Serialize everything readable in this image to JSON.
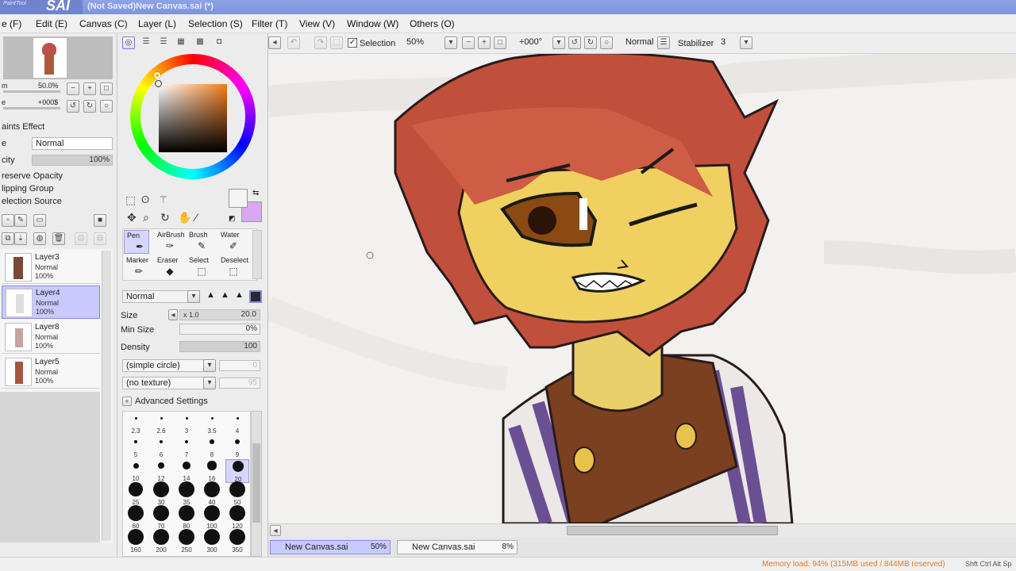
{
  "window": {
    "logo_small": "PaintTool",
    "logo": "SAI",
    "title": "(Not Saved)New Canvas.sai (*)"
  },
  "menu": [
    "e (F)",
    "Edit (E)",
    "Canvas (C)",
    "Layer (L)",
    "Selection (S)",
    "Filter (T)",
    "View (V)",
    "Window (W)",
    "Others (O)"
  ],
  "navigator": {
    "zoom": "50.0%",
    "angle": "+000$"
  },
  "layer_props": {
    "effect_label": "aints Effect",
    "mode_label": "e",
    "mode": "Normal",
    "opacity_label": "city",
    "opacity": "100%",
    "preserve_opacity": "reserve Opacity",
    "clipping_group": "lipping Group",
    "selection_source": "election Source"
  },
  "layers": [
    {
      "name": "Layer3",
      "mode": "Normal",
      "opacity": "100%"
    },
    {
      "name": "Layer4",
      "mode": "Normal",
      "opacity": "100%"
    },
    {
      "name": "Layer8",
      "mode": "Normal",
      "opacity": "100%"
    },
    {
      "name": "Layer5",
      "mode": "Normal",
      "opacity": "100%"
    }
  ],
  "colors": {
    "primary": "#f4f4f4",
    "secondary": "#d9a8f0",
    "ring_marker": "#ffffff",
    "accent_selected": "#c9c9ff"
  },
  "tools": [
    {
      "label": "Pen",
      "icon": "pen-icon"
    },
    {
      "label": "AirBrush",
      "icon": "airbrush-icon"
    },
    {
      "label": "Brush",
      "icon": "brush-icon"
    },
    {
      "label": "Water",
      "icon": "water-icon"
    },
    {
      "label": "Marker",
      "icon": "marker-icon"
    },
    {
      "label": "Eraser",
      "icon": "eraser-icon"
    },
    {
      "label": "Select",
      "icon": "select-icon"
    },
    {
      "label": "Deselect",
      "icon": "deselect-icon"
    }
  ],
  "brush": {
    "blend_mode": "Normal",
    "size_label": "Size",
    "size_mult": "x 1.0",
    "size": "20.0",
    "min_size_label": "Min Size",
    "min_size": "0%",
    "density_label": "Density",
    "density": "100",
    "shape": "(simple circle)",
    "shape_val": "0",
    "texture": "(no texture)",
    "texture_val": "95",
    "advanced": "Advanced Settings"
  },
  "brush_sizes": [
    "2.3",
    "2.6",
    "3",
    "3.5",
    "4",
    "5",
    "6",
    "7",
    "8",
    "9",
    "10",
    "12",
    "14",
    "16",
    "20",
    "25",
    "30",
    "35",
    "40",
    "50",
    "60",
    "70",
    "80",
    "100",
    "120",
    "160",
    "200",
    "250",
    "300",
    "350"
  ],
  "toolbar": {
    "selection_label": "Selection",
    "zoom": "50%",
    "angle": "+000°",
    "mode": "Normal",
    "stabilizer_label": "Stabilizer",
    "stabilizer": "3"
  },
  "tabs": [
    {
      "name": "New Canvas.sai",
      "zoom": "50%"
    },
    {
      "name": "New Canvas.sai",
      "zoom": "8%"
    }
  ],
  "status": {
    "memory": "Memory load: 94% (315MB used / 844MB reserved)",
    "keys": "Shft Ctrl Alt Sp"
  }
}
